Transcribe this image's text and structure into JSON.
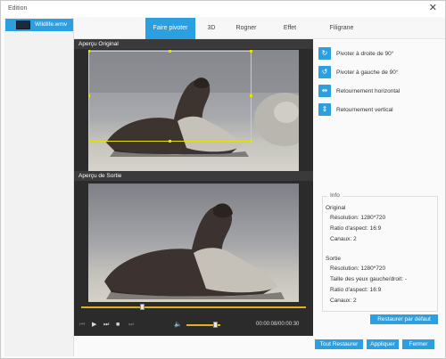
{
  "window": {
    "title": "Edition",
    "close_icon": "close-icon"
  },
  "sidebar": {
    "file_name": "Wildlife.wmv"
  },
  "tabs": [
    {
      "label": "Faire pivoter",
      "active": true
    },
    {
      "label": "3D"
    },
    {
      "label": "Rogner"
    },
    {
      "label": "Effet"
    },
    {
      "label": "Filigrane"
    }
  ],
  "preview": {
    "original_label": "Aperçu Original",
    "output_label": "Aperçu de Sortie",
    "playback_progress": 0.27,
    "volume_level": 0.85,
    "time": "00:00:08/00:00:30",
    "accent_color": "#e0b01d"
  },
  "rotate": {
    "items": [
      {
        "label": "Pivoter à droite de 90°",
        "icon": "rotate-right-icon"
      },
      {
        "label": "Pivoter à gauche de 90°",
        "icon": "rotate-left-icon"
      },
      {
        "label": "Retournement horizontal",
        "icon": "flip-horizontal-icon"
      },
      {
        "label": "Retournement vertical",
        "icon": "flip-vertical-icon"
      }
    ]
  },
  "info": {
    "legend": "Info",
    "original_heading": "Original",
    "original": {
      "resolution": "Résolution: 1280*720",
      "aspect": "Ratio d'aspect: 16:9",
      "channels": "Canaux: 2"
    },
    "output_heading": "Sortie",
    "output": {
      "resolution": "Résolution: 1280*720",
      "eye_size": "Taille des yeux gauche/droit: -",
      "aspect": "Ratio d'aspect: 16:9",
      "channels": "Canaux: 2"
    }
  },
  "buttons": {
    "restore_default": "Restaurer par défaut",
    "restore_all": "Tout Restaurer",
    "apply": "Appliquer",
    "close": "Fermer"
  },
  "colors": {
    "accent": "#2c9fe0"
  }
}
